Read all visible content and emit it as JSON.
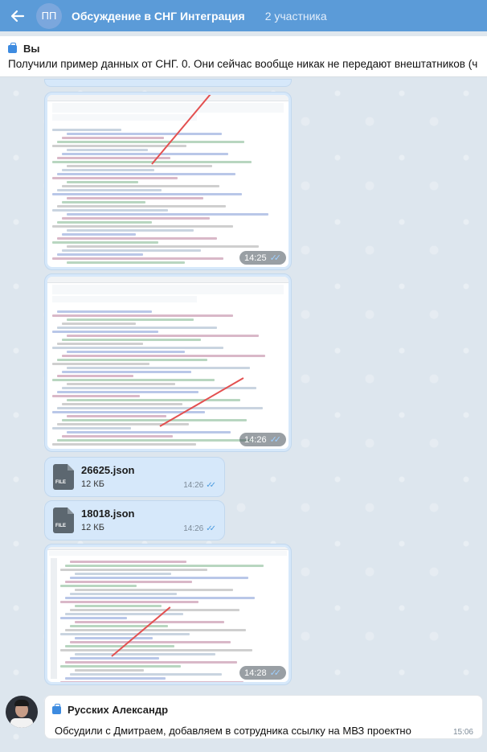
{
  "header": {
    "avatar_initials": "ПП",
    "title": "Обсуждение в СНГ Интеграция",
    "participants": "2 участника"
  },
  "pinned": {
    "author": "Вы",
    "text": "Получили пример данных от СНГ. 0. Они сейчас вообще никак не передают внештатников (ч"
  },
  "messages": [
    {
      "type": "image",
      "time": "14:25"
    },
    {
      "type": "image",
      "time": "14:26"
    },
    {
      "type": "file",
      "name": "26625.json",
      "size": "12 КБ",
      "time": "14:26"
    },
    {
      "type": "file",
      "name": "18018.json",
      "size": "12 КБ",
      "time": "14:26"
    },
    {
      "type": "image",
      "time": "14:28"
    }
  ],
  "incoming": {
    "author": "Русских Александр",
    "text": "Обсудили с Дмитраем, добавляем в сотрудника ссылку на МВЗ проектно",
    "time": "15:06"
  },
  "icons": {
    "back": "arrow-left-icon",
    "file": "file-icon",
    "read_status": "double-check-icon",
    "author_badge": "briefcase-icon"
  },
  "colors": {
    "header": "#5b9bd8",
    "bubble_outgoing": "#d6e8fa",
    "check_read": "#4a9be0"
  }
}
